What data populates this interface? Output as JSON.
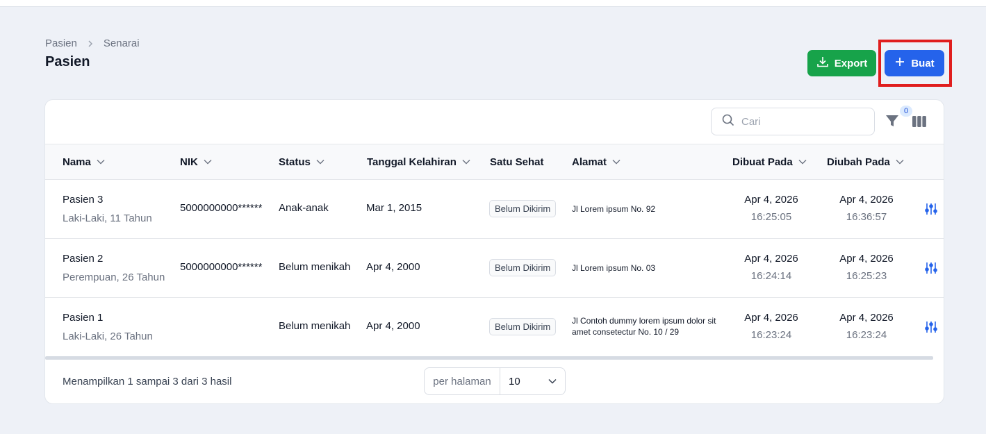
{
  "breadcrumb": {
    "items": [
      "Pasien",
      "Senarai"
    ]
  },
  "page": {
    "title": "Pasien"
  },
  "actions": {
    "export_label": "Export",
    "create_label": "Buat"
  },
  "toolbar": {
    "search_placeholder": "Cari",
    "filter_count": "0"
  },
  "table": {
    "columns": [
      "Nama",
      "NIK",
      "Status",
      "Tanggal Kelahiran",
      "Satu Sehat",
      "Alamat",
      "Dibuat Pada",
      "Diubah Pada"
    ],
    "rows": [
      {
        "name": "Pasien 3",
        "info": "Laki-Laki, 11 Tahun",
        "nik": "5000000000******",
        "status": "Anak-anak",
        "birth_date": "Mar 1, 2015",
        "satu_sehat": "Belum Dikirim",
        "address": "Jl Lorem ipsum No. 92",
        "created_date": "Apr 4, 2026",
        "created_time": "16:25:05",
        "updated_date": "Apr 4, 2026",
        "updated_time": "16:36:57"
      },
      {
        "name": "Pasien 2",
        "info": "Perempuan, 26 Tahun",
        "nik": "5000000000******",
        "status": "Belum menikah",
        "birth_date": "Apr 4, 2000",
        "satu_sehat": "Belum Dikirim",
        "address": "Jl Lorem ipsum No. 03",
        "created_date": "Apr 4, 2026",
        "created_time": "16:24:14",
        "updated_date": "Apr 4, 2026",
        "updated_time": "16:25:23"
      },
      {
        "name": "Pasien 1",
        "info": "Laki-Laki, 26 Tahun",
        "nik": "",
        "status": "Belum menikah",
        "birth_date": "Apr 4, 2000",
        "satu_sehat": "Belum Dikirim",
        "address": "Jl Contoh dummy lorem ipsum dolor sit amet consetectur No. 10 / 29",
        "created_date": "Apr 4, 2026",
        "created_time": "16:23:24",
        "updated_date": "Apr 4, 2026",
        "updated_time": "16:23:24"
      }
    ]
  },
  "pagination": {
    "summary": "Menampilkan 1 sampai 3 dari 3 hasil",
    "per_page_label": "per halaman",
    "per_page_value": "10"
  },
  "colors": {
    "export_button": "#17a34a",
    "create_button": "#2563eb",
    "highlight_border": "#e01e1e",
    "action_icon": "#2563eb",
    "page_background": "#eef1f7"
  }
}
